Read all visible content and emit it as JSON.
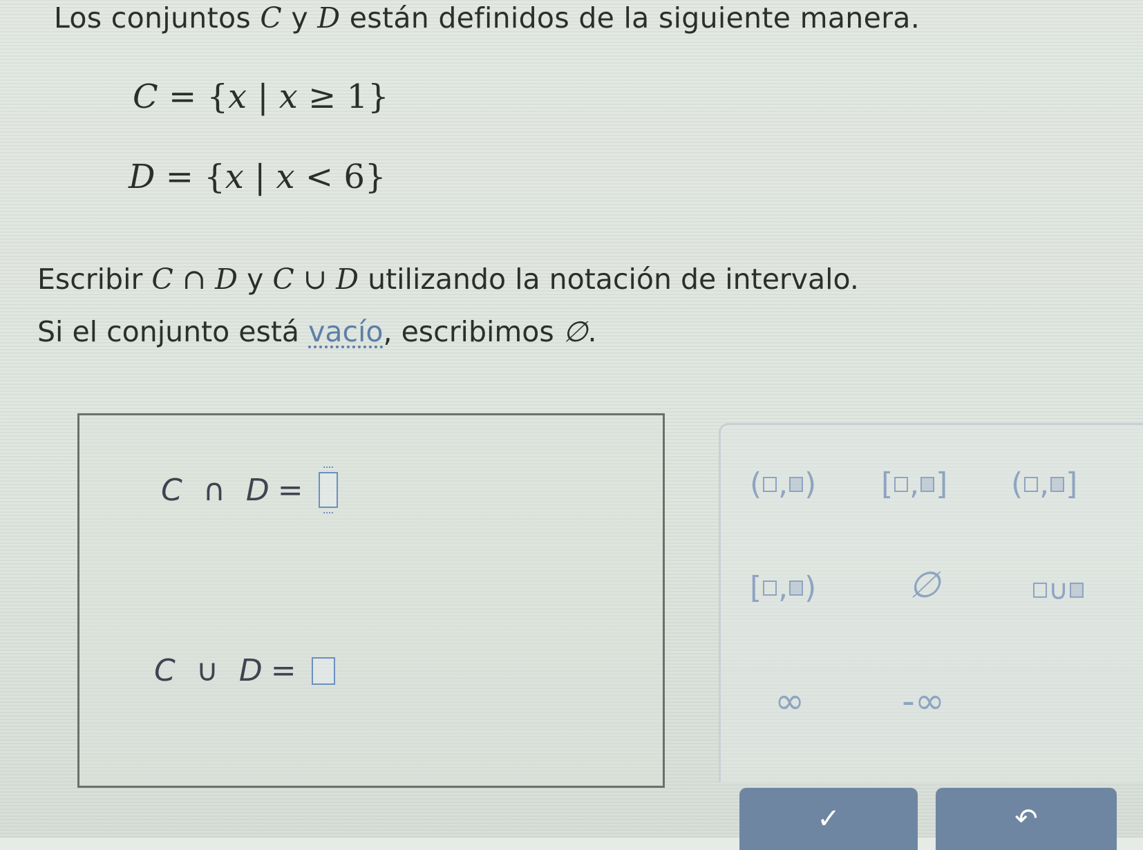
{
  "problem": {
    "intro_before": "Los conjuntos ",
    "var_c": "C",
    "intro_y": " y ",
    "var_d": "D",
    "intro_after": " están definidos de la siguiente manera.",
    "set_c": {
      "name": "C",
      "eq": " = ",
      "open": "{",
      "var": "x",
      "bar": " | ",
      "cond_var": "x",
      "cond": " ≥ 1",
      "close": "}"
    },
    "set_d": {
      "name": "D",
      "eq": " = ",
      "open": "{",
      "var": "x",
      "bar": " | ",
      "cond_var": "x",
      "cond": " < 6",
      "close": "}"
    },
    "instr1_before": "Escribir ",
    "instr1_expr1": "C ∩ D",
    "instr1_y": " y ",
    "instr1_expr2": "C ∪ D",
    "instr1_after": " utilizando la notación de intervalo.",
    "instr2_before": "Si el conjunto está ",
    "instr2_link": "vacío",
    "instr2_after": ", escribimos ",
    "instr2_symbol": "∅",
    "instr2_end": "."
  },
  "answer": {
    "intersection": {
      "label": "C ∩ D",
      "eq": "=",
      "value": ""
    },
    "union": {
      "label": "C ∪ D",
      "eq": "=",
      "value": ""
    }
  },
  "palette": {
    "open_paren": "(",
    "close_paren": ")",
    "open_bracket": "[",
    "close_bracket": "]",
    "comma": ",",
    "empty_set": "∅",
    "union_op": "∪",
    "infinity": "∞",
    "neg_infinity": "-∞"
  },
  "actions": {
    "check": "✓",
    "undo": "↶"
  },
  "colors": {
    "accent": "#6c8fbf",
    "palette_symbol": "#8ea4c2",
    "action_button": "#6f86a2"
  }
}
